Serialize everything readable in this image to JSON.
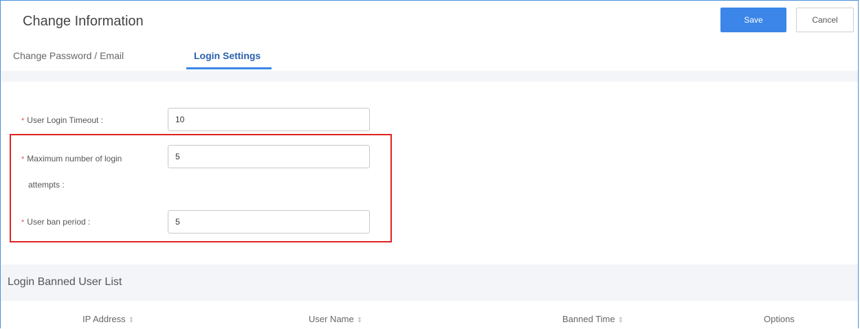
{
  "header": {
    "title": "Change Information",
    "save_label": "Save",
    "cancel_label": "Cancel"
  },
  "tabs": [
    {
      "label": "Change Password / Email",
      "active": false
    },
    {
      "label": "Login Settings",
      "active": true
    }
  ],
  "form": {
    "required_marker": "*",
    "timeout": {
      "label": "User Login Timeout :",
      "value": "10"
    },
    "max_attempts": {
      "label_line1": "Maximum number of login",
      "label_line2": "attempts :",
      "value": "5"
    },
    "ban_period": {
      "label": "User ban period :",
      "value": "5"
    }
  },
  "banned_list": {
    "title": "Login Banned User List",
    "sort_icon": "sort-icon",
    "columns": [
      {
        "label": "IP Address",
        "sortable": true
      },
      {
        "label": "User Name",
        "sortable": true
      },
      {
        "label": "Banned Time",
        "sortable": true
      },
      {
        "label": "Options",
        "sortable": false
      }
    ]
  },
  "colors": {
    "accent": "#3b86e8",
    "highlight_border": "#e02020",
    "required": "#e05050"
  }
}
